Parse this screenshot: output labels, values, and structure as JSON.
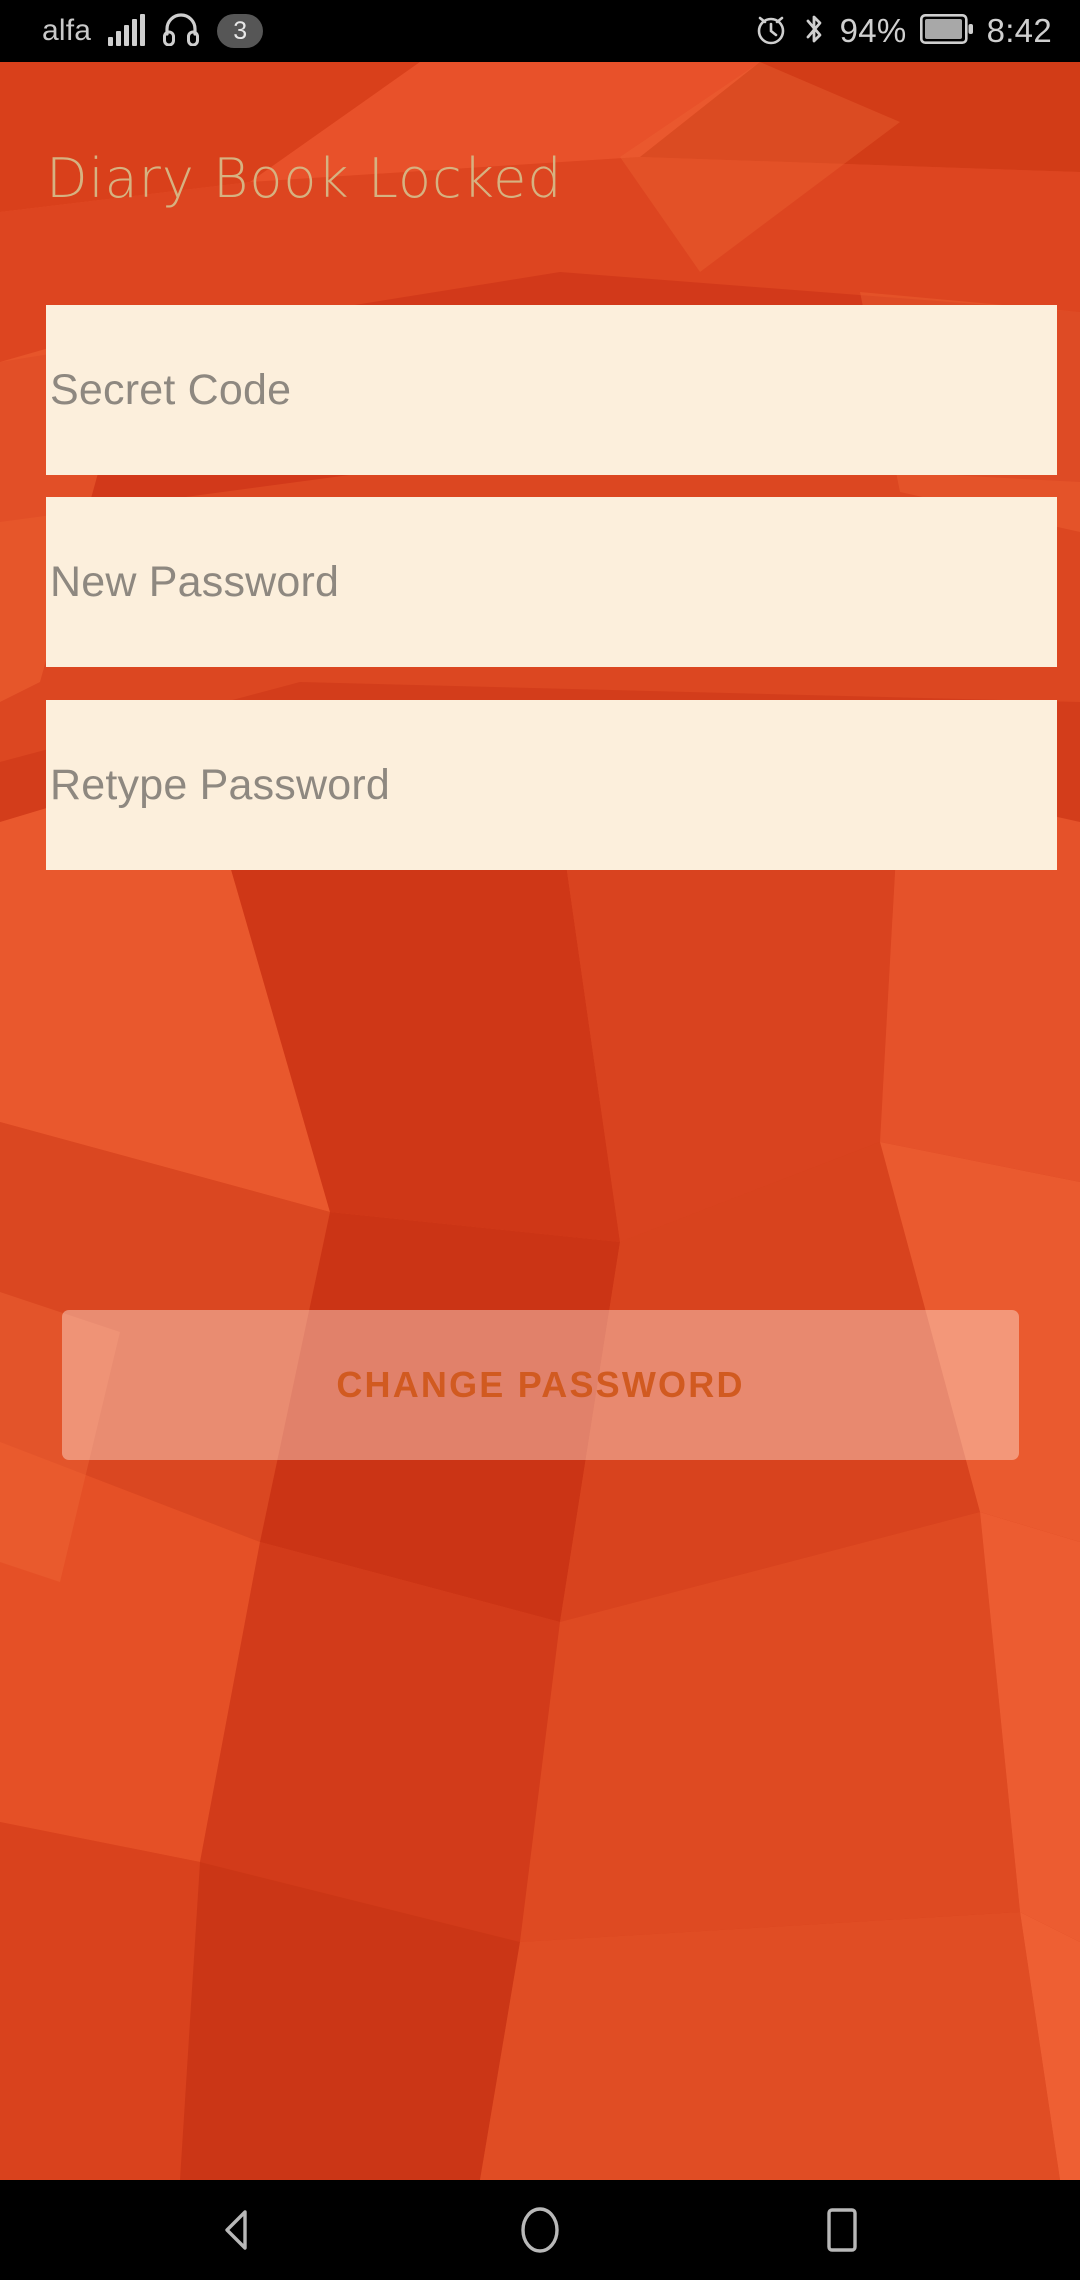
{
  "status_bar": {
    "carrier": "alfa",
    "notification_count": "3",
    "battery_percent": "94%",
    "time": "8:42",
    "icons": [
      "signal-bars-icon",
      "headphones-icon",
      "notification-badge",
      "alarm-clock-icon",
      "bluetooth-icon",
      "battery-icon"
    ]
  },
  "app": {
    "title": "Diary Book Locked",
    "title_color": "#d6b281",
    "background_color": "#e04a23",
    "field_background": "#fcefdc",
    "fields": [
      {
        "name": "secret-code",
        "placeholder": "Secret Code",
        "value": ""
      },
      {
        "name": "new-password",
        "placeholder": "New Password",
        "value": ""
      },
      {
        "name": "retype-password",
        "placeholder": "Retype Password",
        "value": ""
      }
    ],
    "button": {
      "label": "CHANGE PASSWORD",
      "text_color": "#d0571a"
    }
  },
  "nav_bar": {
    "back_label": "back-icon",
    "home_label": "home-icon",
    "recents_label": "recents-icon"
  }
}
